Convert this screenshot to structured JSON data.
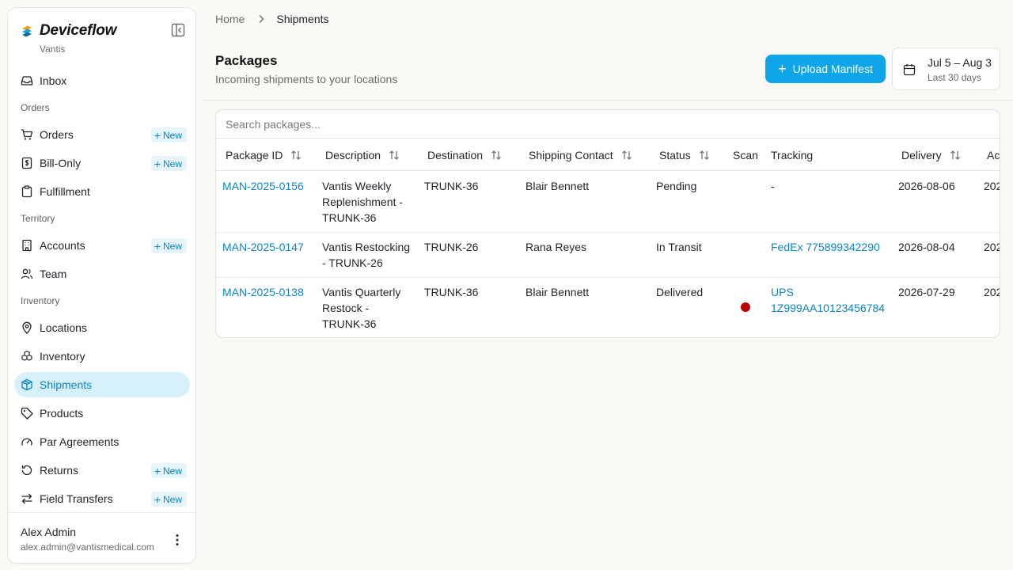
{
  "brand": {
    "name": "Deviceflow",
    "org": "Vantis"
  },
  "sidebar": {
    "new_label": "New",
    "inbox": "Inbox",
    "sections": {
      "orders": "Orders",
      "territory": "Territory",
      "inventory": "Inventory"
    },
    "items": {
      "orders": "Orders",
      "bill_only": "Bill-Only",
      "fulfillment": "Fulfillment",
      "accounts": "Accounts",
      "team": "Team",
      "locations": "Locations",
      "inventory": "Inventory",
      "shipments": "Shipments",
      "products": "Products",
      "par_agreements": "Par Agreements",
      "returns": "Returns",
      "field_transfers": "Field Transfers"
    }
  },
  "user": {
    "name": "Alex Admin",
    "email": "alex.admin@vantismedical.com"
  },
  "breadcrumb": {
    "home": "Home",
    "current": "Shipments"
  },
  "page": {
    "title": "Packages",
    "subtitle": "Incoming shipments to your locations"
  },
  "actions": {
    "upload": "Upload Manifest"
  },
  "date_filter": {
    "range": "Jul 5 – Aug 3",
    "sub": "Last 30 days"
  },
  "search": {
    "placeholder": "Search packages..."
  },
  "table": {
    "columns": {
      "package_id": "Package ID",
      "description": "Description",
      "destination": "Destination",
      "contact": "Shipping Contact",
      "status": "Status",
      "scan": "Scan",
      "tracking": "Tracking",
      "delivery": "Delivery",
      "actions": "Ac"
    },
    "rows": [
      {
        "id": "MAN-2025-0156",
        "desc": [
          "Vantis Weekly",
          "Replenishment -",
          "TRUNK-36"
        ],
        "destination": "TRUNK-36",
        "contact": "Blair Bennett",
        "status": "Pending",
        "tracking": [
          "-"
        ],
        "tracking_link": false,
        "delivery": "2026-08-06",
        "extra": "202"
      },
      {
        "id": "MAN-2025-0147",
        "desc": [
          "Vantis Restocking",
          "- TRUNK-26"
        ],
        "destination": "TRUNK-26",
        "contact": "Rana Reyes",
        "status": "In Transit",
        "tracking": [
          "FedEx 775899342290"
        ],
        "tracking_link": true,
        "delivery": "2026-08-04",
        "extra": "202"
      },
      {
        "id": "MAN-2025-0138",
        "desc": [
          "Vantis Quarterly",
          "Restock -",
          "TRUNK-36"
        ],
        "destination": "TRUNK-36",
        "contact": "Blair Bennett",
        "status": "Delivered",
        "scan_color": "#c00000",
        "tracking": [
          "UPS",
          "1Z999AA10123456784"
        ],
        "tracking_link": true,
        "delivery": "2026-07-29",
        "extra": "202"
      }
    ]
  },
  "colors": {
    "accent": "#0ea5e9",
    "link": "#0b84c6",
    "active_bg": "#d6f1fb",
    "scan_alert": "#c00000"
  }
}
